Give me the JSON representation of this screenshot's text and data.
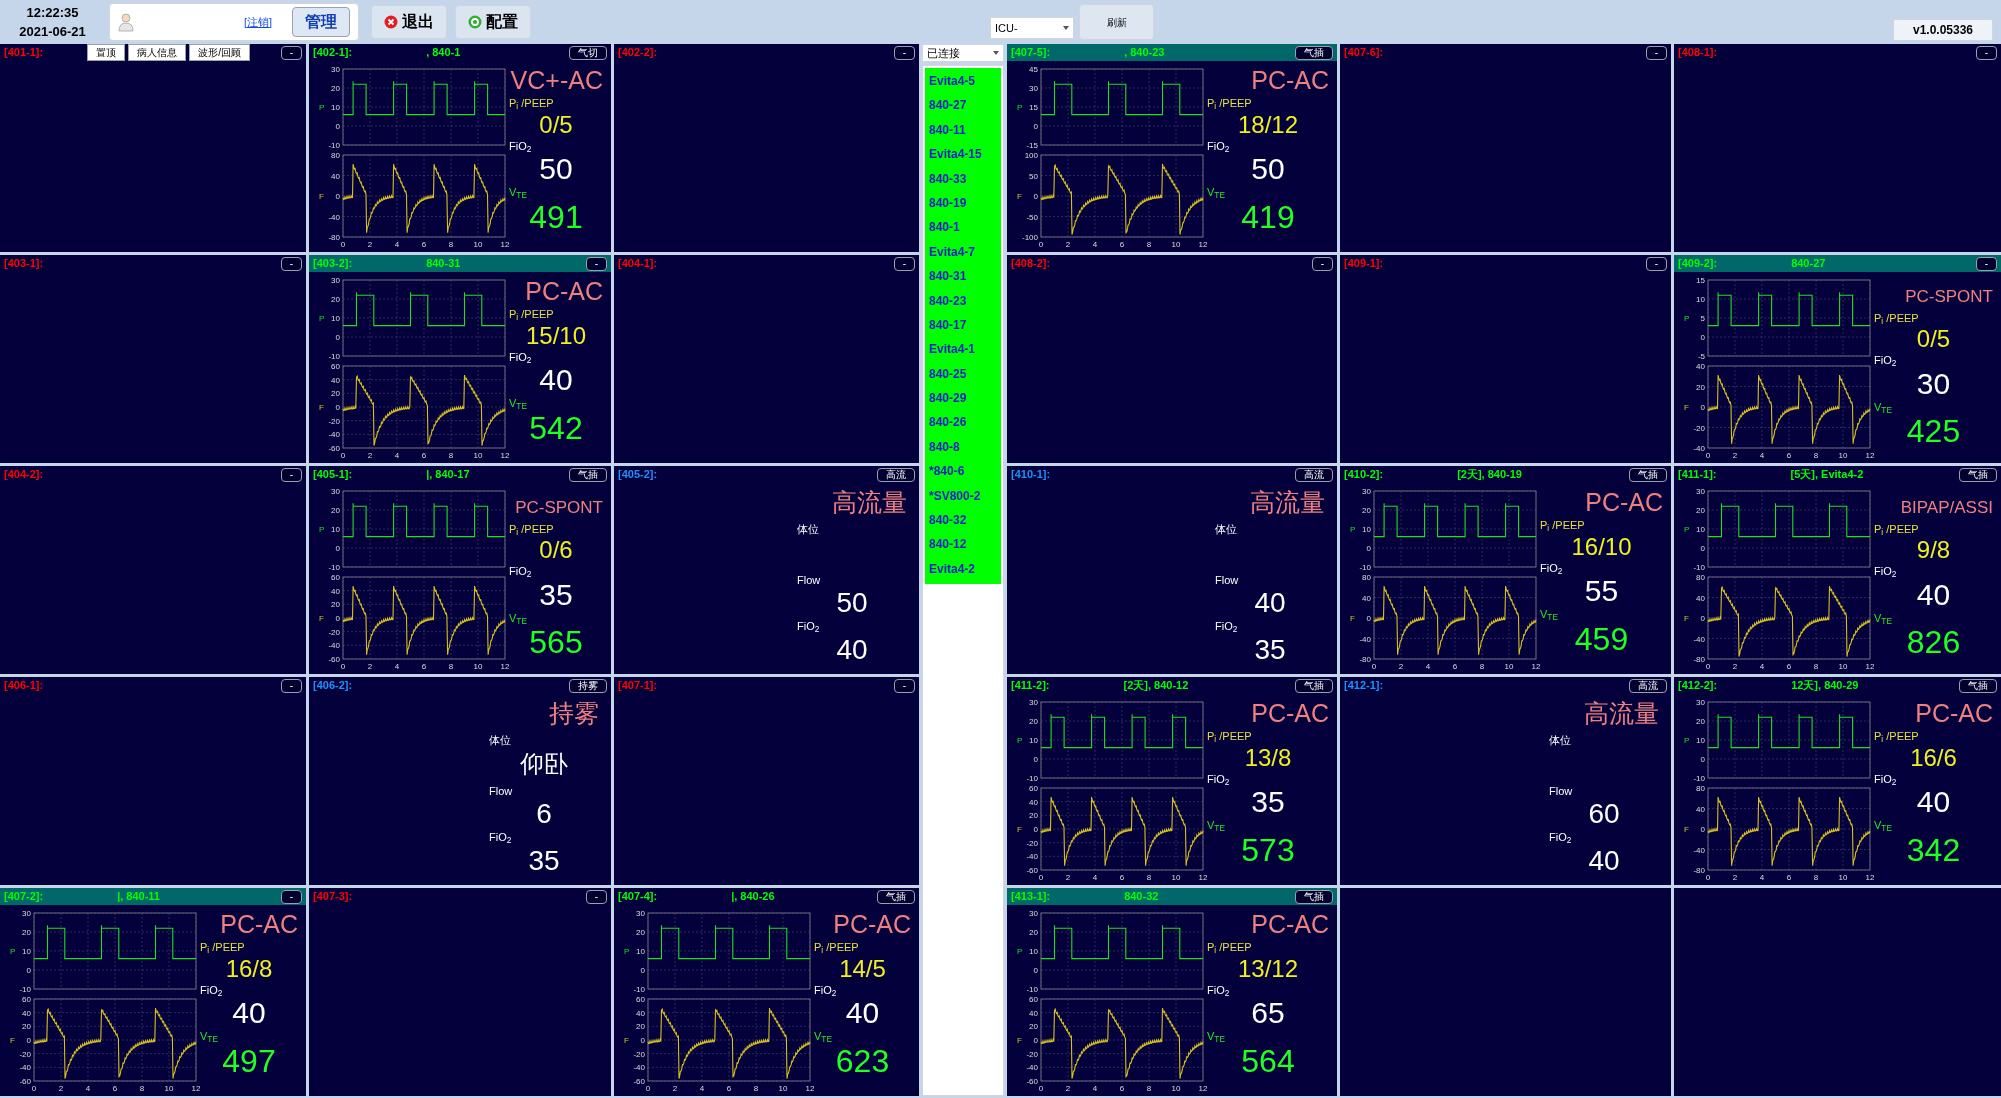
{
  "top_bar": {
    "time": "12:22:35",
    "date": "2021-06-21",
    "logout_link": "[注销]",
    "manage_button": "管理",
    "exit_button": "退出",
    "config_button": "配置",
    "unit_select": "ICU-",
    "refresh_button": "刷新",
    "version": "v1.0.05336"
  },
  "left_beds": [
    {
      "kind": "empty",
      "label": "[401-1]:",
      "color": "#ff0000",
      "tag": "-",
      "buttons": [
        "置顶",
        "病人信息",
        "波形/回顾"
      ]
    },
    {
      "kind": "vent",
      "label": "[402-1]:",
      "color": "#00ff00",
      "device": ", 840-1",
      "highlighted": false,
      "tag": "气切",
      "mode": "VC+-AC",
      "p_ticks": [
        "30",
        "20",
        "10",
        "0",
        "-10"
      ],
      "f_ticks": [
        "80",
        "40",
        "0",
        "-40",
        "-80"
      ],
      "x_ticks": [
        "0",
        "2",
        "4",
        "6",
        "8",
        "10",
        "12"
      ],
      "pressure_label": "P",
      "flow_label": "F",
      "pi_peep_label": "P$_{i}$ /PEEP",
      "pi_peep": "0/5",
      "fio2_label": "FiO$_{2}$",
      "fio2": "50",
      "vte_label": "V$_{TE}$",
      "vte": "491"
    },
    {
      "kind": "empty",
      "label": "[402-2]:",
      "color": "#ff0000",
      "tag": "-"
    },
    {
      "kind": "empty",
      "label": "[403-1]:",
      "color": "#ff0000",
      "tag": "-"
    },
    {
      "kind": "vent",
      "label": "[403-2]:",
      "color": "#00ff00",
      "device": "840-31",
      "highlighted": true,
      "tag": "-",
      "mode": "PC-AC",
      "p_ticks": [
        "30",
        "20",
        "10",
        "0",
        "-10"
      ],
      "f_ticks": [
        "60",
        "40",
        "20",
        "0",
        "-20",
        "-40",
        "-60"
      ],
      "x_ticks": [
        "0",
        "2",
        "4",
        "6",
        "8",
        "10",
        "12"
      ],
      "pressure_label": "P",
      "flow_label": "F",
      "pi_peep_label": "P$_{i}$ /PEEP",
      "pi_peep": "15/10",
      "fio2_label": "FiO$_{2}$",
      "fio2": "40",
      "vte_label": "V$_{TE}$",
      "vte": "542"
    },
    {
      "kind": "empty",
      "label": "[404-1]:",
      "color": "#ff0000",
      "tag": "-"
    },
    {
      "kind": "empty",
      "label": "[404-2]:",
      "color": "#ff0000",
      "tag": "-"
    },
    {
      "kind": "vent",
      "label": "[405-1]:",
      "color": "#00ff00",
      "device": "|, 840-17",
      "highlighted": false,
      "tag": "气插",
      "mode": "PC-SPONT",
      "p_ticks": [
        "30",
        "20",
        "10",
        "0",
        "-10"
      ],
      "f_ticks": [
        "60",
        "40",
        "20",
        "0",
        "-20",
        "-40",
        "-60"
      ],
      "x_ticks": [
        "0",
        "2",
        "4",
        "6",
        "8",
        "10",
        "12"
      ],
      "pressure_label": "P",
      "flow_label": "F",
      "pi_peep_label": "P$_{i}$ /PEEP",
      "pi_peep": "0/6",
      "fio2_label": "FiO$_{2}$",
      "fio2": "35",
      "vte_label": "V$_{TE}$",
      "vte": "565"
    },
    {
      "kind": "flow",
      "label": "[405-2]:",
      "color": "#1e90ff",
      "tag": "高流",
      "mode": "高流量",
      "position_label": "体位",
      "flow_label": "Flow",
      "flow": "50",
      "fio2_label": "FiO$_{2}$",
      "fio2": "40"
    },
    {
      "kind": "empty",
      "label": "[406-1]:",
      "color": "#ff0000",
      "tag": "-"
    },
    {
      "kind": "flow",
      "label": "[406-2]:",
      "color": "#1e90ff",
      "tag": "持雾",
      "mode": "持雾",
      "position_label": "体位",
      "position": "仰卧",
      "flow_label": "Flow",
      "flow": "6",
      "fio2_label": "FiO$_{2}$",
      "fio2": "35"
    },
    {
      "kind": "empty",
      "label": "[407-1]:",
      "color": "#ff0000",
      "tag": "-"
    },
    {
      "kind": "vent",
      "label": "[407-2]:",
      "color": "#00ff00",
      "device": "|, 840-11",
      "highlighted": true,
      "tag": "-",
      "mode": "PC-AC",
      "p_ticks": [
        "30",
        "20",
        "10",
        "0",
        "-10"
      ],
      "f_ticks": [
        "60",
        "40",
        "20",
        "0",
        "-20",
        "-40",
        "-60"
      ],
      "x_ticks": [
        "0",
        "2",
        "4",
        "6",
        "8",
        "10",
        "12"
      ],
      "pressure_label": "P",
      "flow_label": "F",
      "pi_peep_label": "P$_{i}$ /PEEP",
      "pi_peep": "16/8",
      "fio2_label": "FiO$_{2}$",
      "fio2": "40",
      "vte_label": "V$_{TE}$",
      "vte": "497"
    },
    {
      "kind": "empty",
      "label": "[407-3]:",
      "color": "#ff0000",
      "tag": "-"
    },
    {
      "kind": "vent",
      "label": "[407-4]:",
      "color": "#00ff00",
      "device": "|, 840-26",
      "highlighted": false,
      "tag": "气插",
      "mode": "PC-AC",
      "p_ticks": [
        "30",
        "20",
        "10",
        "0",
        "-10"
      ],
      "f_ticks": [
        "60",
        "40",
        "20",
        "0",
        "-20",
        "-40",
        "-60"
      ],
      "x_ticks": [
        "0",
        "2",
        "4",
        "6",
        "8",
        "10",
        "12"
      ],
      "pressure_label": "P",
      "flow_label": "F",
      "pi_peep_label": "P$_{i}$ /PEEP",
      "pi_peep": "14/5",
      "fio2_label": "FiO$_{2}$",
      "fio2": "40",
      "vte_label": "V$_{TE}$",
      "vte": "623"
    }
  ],
  "device_panel": {
    "status_select": "已连接",
    "devices": [
      "Evita4-5",
      "840-27",
      "840-11",
      "Evita4-15",
      "840-33",
      "840-19",
      "840-1",
      "Evita4-7",
      "840-31",
      "840-23",
      "840-17",
      "Evita4-1",
      "840-25",
      "840-29",
      "840-26",
      "840-8",
      "*840-6",
      "*SV800-2",
      "840-32",
      "840-12",
      "Evita4-2"
    ]
  },
  "right_beds": [
    {
      "kind": "vent",
      "label": "[407-5]:",
      "color": "#00ff00",
      "device": ", 840-23",
      "highlighted": true,
      "tag": "气插",
      "mode": "PC-AC",
      "p_ticks": [
        "45",
        "30",
        "15",
        "0",
        "-15"
      ],
      "f_ticks": [
        "100",
        "50",
        "0",
        "-50",
        "-100"
      ],
      "x_ticks": [
        "0",
        "2",
        "4",
        "6",
        "8",
        "10",
        "12"
      ],
      "pressure_label": "P",
      "flow_label": "F",
      "pi_peep_label": "P$_{i}$ /PEEP",
      "pi_peep": "18/12",
      "fio2_label": "FiO$_{2}$",
      "fio2": "50",
      "vte_label": "V$_{TE}$",
      "vte": "419"
    },
    {
      "kind": "empty",
      "label": "[407-6]:",
      "color": "#ff0000",
      "tag": "-"
    },
    {
      "kind": "empty",
      "label": "[408-1]:",
      "color": "#ff0000",
      "tag": "-"
    },
    {
      "kind": "empty",
      "label": "[408-2]:",
      "color": "#ff0000",
      "tag": "-"
    },
    {
      "kind": "empty",
      "label": "[409-1]:",
      "color": "#ff0000",
      "tag": "-"
    },
    {
      "kind": "vent",
      "label": "[409-2]:",
      "color": "#00ff00",
      "device": "840-27",
      "highlighted": true,
      "tag": "-",
      "mode": "PC-SPONT",
      "p_ticks": [
        "15",
        "10",
        "5",
        "0",
        "-5"
      ],
      "f_ticks": [
        "40",
        "20",
        "0",
        "-20",
        "-40"
      ],
      "x_ticks": [
        "0",
        "2",
        "4",
        "6",
        "8",
        "10",
        "12"
      ],
      "pressure_label": "P",
      "flow_label": "F",
      "pi_peep_label": "P$_{i}$ /PEEP",
      "pi_peep": "0/5",
      "fio2_label": "FiO$_{2}$",
      "fio2": "30",
      "vte_label": "V$_{TE}$",
      "vte": "425"
    },
    {
      "kind": "flow",
      "label": "[410-1]:",
      "color": "#1e90ff",
      "tag": "高流",
      "mode": "高流量",
      "position_label": "体位",
      "flow_label": "Flow",
      "flow": "40",
      "fio2_label": "FiO$_{2}$",
      "fio2": "35"
    },
    {
      "kind": "vent",
      "label": "[410-2]:",
      "color": "#00ff00",
      "device": "[2天], 840-19",
      "highlighted": false,
      "tag": "气插",
      "mode": "PC-AC",
      "p_ticks": [
        "30",
        "20",
        "10",
        "0",
        "-10"
      ],
      "f_ticks": [
        "80",
        "40",
        "0",
        "-40",
        "-80"
      ],
      "x_ticks": [
        "0",
        "2",
        "4",
        "6",
        "8",
        "10",
        "12"
      ],
      "pressure_label": "P",
      "flow_label": "F",
      "pi_peep_label": "P$_{i}$ /PEEP",
      "pi_peep": "16/10",
      "fio2_label": "FiO$_{2}$",
      "fio2": "55",
      "vte_label": "V$_{TE}$",
      "vte": "459"
    },
    {
      "kind": "vent",
      "label": "[411-1]:",
      "color": "#00ff00",
      "device": "[5天], Evita4-2",
      "highlighted": false,
      "tag": "气插",
      "mode": "BIPAP/ASSI",
      "p_ticks": [
        "30",
        "20",
        "10",
        "0",
        "-10"
      ],
      "f_ticks": [
        "80",
        "40",
        "0",
        "-40",
        "-80"
      ],
      "x_ticks": [
        "0",
        "2",
        "4",
        "6",
        "8",
        "10",
        "12"
      ],
      "pressure_label": "P",
      "flow_label": "F",
      "pi_peep_label": "P$_{i}$ /PEEP",
      "pi_peep": "9/8",
      "fio2_label": "FiO$_{2}$",
      "fio2": "40",
      "vte_label": "V$_{TE}$",
      "vte": "826"
    },
    {
      "kind": "vent",
      "label": "[411-2]:",
      "color": "#00ff00",
      "device": "[2天], 840-12",
      "highlighted": false,
      "tag": "气插",
      "mode": "PC-AC",
      "p_ticks": [
        "30",
        "20",
        "10",
        "0",
        "-10"
      ],
      "f_ticks": [
        "60",
        "40",
        "20",
        "0",
        "-20",
        "-40",
        "-60"
      ],
      "x_ticks": [
        "0",
        "2",
        "4",
        "6",
        "8",
        "10",
        "12"
      ],
      "pressure_label": "P",
      "flow_label": "F",
      "pi_peep_label": "P$_{i}$ /PEEP",
      "pi_peep": "13/8",
      "fio2_label": "FiO$_{2}$",
      "fio2": "35",
      "vte_label": "V$_{TE}$",
      "vte": "573"
    },
    {
      "kind": "flow",
      "label": "[412-1]:",
      "color": "#1e90ff",
      "tag": "高流",
      "mode": "高流量",
      "position_label": "体位",
      "flow_label": "Flow",
      "flow": "60",
      "fio2_label": "FiO$_{2}$",
      "fio2": "40"
    },
    {
      "kind": "vent",
      "label": "[412-2]:",
      "color": "#00ff00",
      "device": "12天], 840-29",
      "highlighted": false,
      "tag": "气插",
      "mode": "PC-AC",
      "p_ticks": [
        "30",
        "20",
        "10",
        "0",
        "-10"
      ],
      "f_ticks": [
        "80",
        "40",
        "0",
        "-40",
        "-80"
      ],
      "x_ticks": [
        "0",
        "2",
        "4",
        "6",
        "8",
        "10",
        "12"
      ],
      "pressure_label": "P",
      "flow_label": "F",
      "pi_peep_label": "P$_{i}$ /PEEP",
      "pi_peep": "16/6",
      "fio2_label": "FiO$_{2}$",
      "fio2": "40",
      "vte_label": "V$_{TE}$",
      "vte": "342"
    },
    {
      "kind": "vent",
      "label": "[413-1]:",
      "color": "#00ff00",
      "device": "840-32",
      "highlighted": true,
      "tag": "气插",
      "mode": "PC-AC",
      "p_ticks": [
        "30",
        "20",
        "10",
        "0",
        "-10"
      ],
      "f_ticks": [
        "60",
        "40",
        "20",
        "0",
        "-20",
        "-40",
        "-60"
      ],
      "x_ticks": [
        "0",
        "2",
        "4",
        "6",
        "8",
        "10",
        "12"
      ],
      "pressure_label": "P",
      "flow_label": "F",
      "pi_peep_label": "P$_{i}$ /PEEP",
      "pi_peep": "13/12",
      "fio2_label": "FiO$_{2}$",
      "fio2": "65",
      "vte_label": "V$_{TE}$",
      "vte": "564"
    },
    {
      "kind": "blank"
    },
    {
      "kind": "blank"
    }
  ]
}
